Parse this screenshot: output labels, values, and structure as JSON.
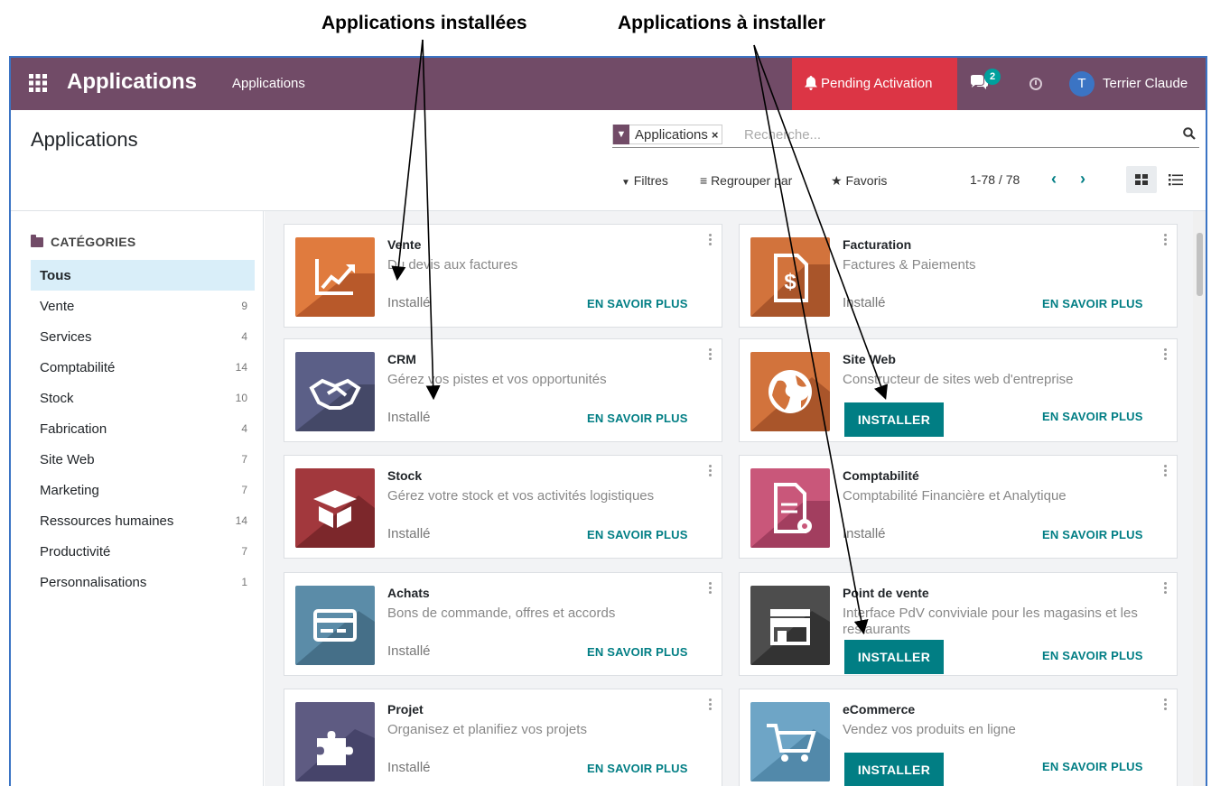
{
  "annotations": {
    "installed_label": "Applications installées",
    "to_install_label": "Applications à installer"
  },
  "topbar": {
    "app_name": "Applications",
    "menu_link": "Applications",
    "pending": "Pending Activation",
    "chat_count": "2",
    "avatar_initial": "T",
    "user_name": "Terrier Claude",
    "bar_color": "#714b67",
    "pending_color": "#dc3545"
  },
  "control": {
    "breadcrumb": "Applications",
    "facet_label": "Applications",
    "facet_remove": "×",
    "search_placeholder": "Recherche...",
    "filters": "Filtres",
    "group_by": "Regrouper par",
    "favorites": "Favoris",
    "pager": "1-78 / 78"
  },
  "sidebar": {
    "header": "CATÉGORIES",
    "items": [
      {
        "label": "Tous",
        "count": ""
      },
      {
        "label": "Vente",
        "count": "9"
      },
      {
        "label": "Services",
        "count": "4"
      },
      {
        "label": "Comptabilité",
        "count": "14"
      },
      {
        "label": "Stock",
        "count": "10"
      },
      {
        "label": "Fabrication",
        "count": "4"
      },
      {
        "label": "Site Web",
        "count": "7"
      },
      {
        "label": "Marketing",
        "count": "7"
      },
      {
        "label": "Ressources humaines",
        "count": "14"
      },
      {
        "label": "Productivité",
        "count": "7"
      },
      {
        "label": "Personnalisations",
        "count": "1"
      }
    ]
  },
  "apps": [
    {
      "name": "Vente",
      "summary": "Du devis aux factures",
      "installed": true,
      "status": "Installé",
      "learn": "EN SAVOIR PLUS",
      "install": "",
      "icon": "sales-icon",
      "color": "#e07b3e"
    },
    {
      "name": "Facturation",
      "summary": "Factures & Paiements",
      "installed": true,
      "status": "Installé",
      "learn": "EN SAVOIR PLUS",
      "install": "",
      "icon": "invoice-icon",
      "color": "#d2733c"
    },
    {
      "name": "CRM",
      "summary": "Gérez vos pistes et vos opportunités",
      "installed": true,
      "status": "Installé",
      "learn": "EN SAVOIR PLUS",
      "install": "",
      "icon": "handshake-icon",
      "color": "#5b5f87"
    },
    {
      "name": "Site Web",
      "summary": "Constructeur de sites web d'entreprise",
      "installed": false,
      "status": "",
      "learn": "EN SAVOIR PLUS",
      "install": "INSTALLER",
      "icon": "globe-icon",
      "color": "#d2733c"
    },
    {
      "name": "Stock",
      "summary": "Gérez votre stock et vos activités logistiques",
      "installed": true,
      "status": "Installé",
      "learn": "EN SAVOIR PLUS",
      "install": "",
      "icon": "box-icon",
      "color": "#a2383d"
    },
    {
      "name": "Comptabilité",
      "summary": "Comptabilité Financière et Analytique",
      "installed": true,
      "status": "Installé",
      "learn": "EN SAVOIR PLUS",
      "install": "",
      "icon": "accounting-icon",
      "color": "#c9577a"
    },
    {
      "name": "Achats",
      "summary": "Bons de commande, offres et accords",
      "installed": true,
      "status": "Installé",
      "learn": "EN SAVOIR PLUS",
      "install": "",
      "icon": "card-icon",
      "color": "#5b8ca8"
    },
    {
      "name": "Point de vente",
      "summary": "Interface PdV conviviale pour les magasins et les restaurants",
      "installed": false,
      "status": "",
      "learn": "EN SAVOIR PLUS",
      "install": "INSTALLER",
      "icon": "shop-icon",
      "color": "#4d4d4d"
    },
    {
      "name": "Projet",
      "summary": "Organisez et planifiez vos projets",
      "installed": true,
      "status": "Installé",
      "learn": "EN SAVOIR PLUS",
      "install": "",
      "icon": "puzzle-icon",
      "color": "#5e5b82"
    },
    {
      "name": "eCommerce",
      "summary": "Vendez vos produits en ligne",
      "installed": false,
      "status": "",
      "learn": "EN SAVOIR PLUS",
      "install": "INSTALLER",
      "icon": "cart-icon",
      "color": "#6ea5c6"
    }
  ],
  "accent_color": "#017e84"
}
